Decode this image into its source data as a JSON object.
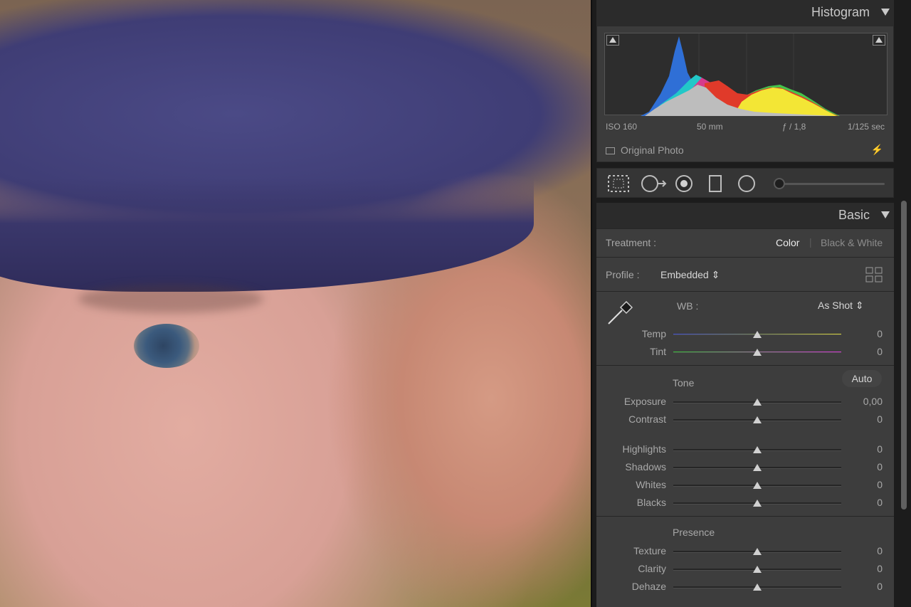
{
  "histogram": {
    "title": "Histogram",
    "exif": {
      "iso": "ISO 160",
      "focal": "50 mm",
      "aperture": "ƒ / 1,8",
      "shutter": "1/125 sec"
    },
    "original_photo_label": "Original Photo"
  },
  "tools": [
    "crop-overlay",
    "spot-removal",
    "red-eye",
    "graduated-filter",
    "radial-filter",
    "adjustment-brush"
  ],
  "basic": {
    "title": "Basic",
    "treatment": {
      "label": "Treatment :",
      "color": "Color",
      "bw": "Black & White"
    },
    "profile": {
      "label": "Profile :",
      "value": "Embedded ⇕"
    },
    "wb": {
      "label": "WB :",
      "value": "As Shot ⇕",
      "sliders": [
        {
          "name": "Temp",
          "value": "0",
          "pos": 0.5
        },
        {
          "name": "Tint",
          "value": "0",
          "pos": 0.5
        }
      ]
    },
    "tone": {
      "label": "Tone",
      "auto": "Auto",
      "sliders": [
        {
          "name": "Exposure",
          "value": "0,00",
          "pos": 0.5
        },
        {
          "name": "Contrast",
          "value": "0",
          "pos": 0.5
        },
        {
          "name": "Highlights",
          "value": "0",
          "pos": 0.5
        },
        {
          "name": "Shadows",
          "value": "0",
          "pos": 0.5
        },
        {
          "name": "Whites",
          "value": "0",
          "pos": 0.5
        },
        {
          "name": "Blacks",
          "value": "0",
          "pos": 0.5
        }
      ]
    },
    "presence": {
      "label": "Presence",
      "sliders": [
        {
          "name": "Texture",
          "value": "0",
          "pos": 0.5
        },
        {
          "name": "Clarity",
          "value": "0",
          "pos": 0.5
        },
        {
          "name": "Dehaze",
          "value": "0",
          "pos": 0.5
        }
      ]
    }
  }
}
